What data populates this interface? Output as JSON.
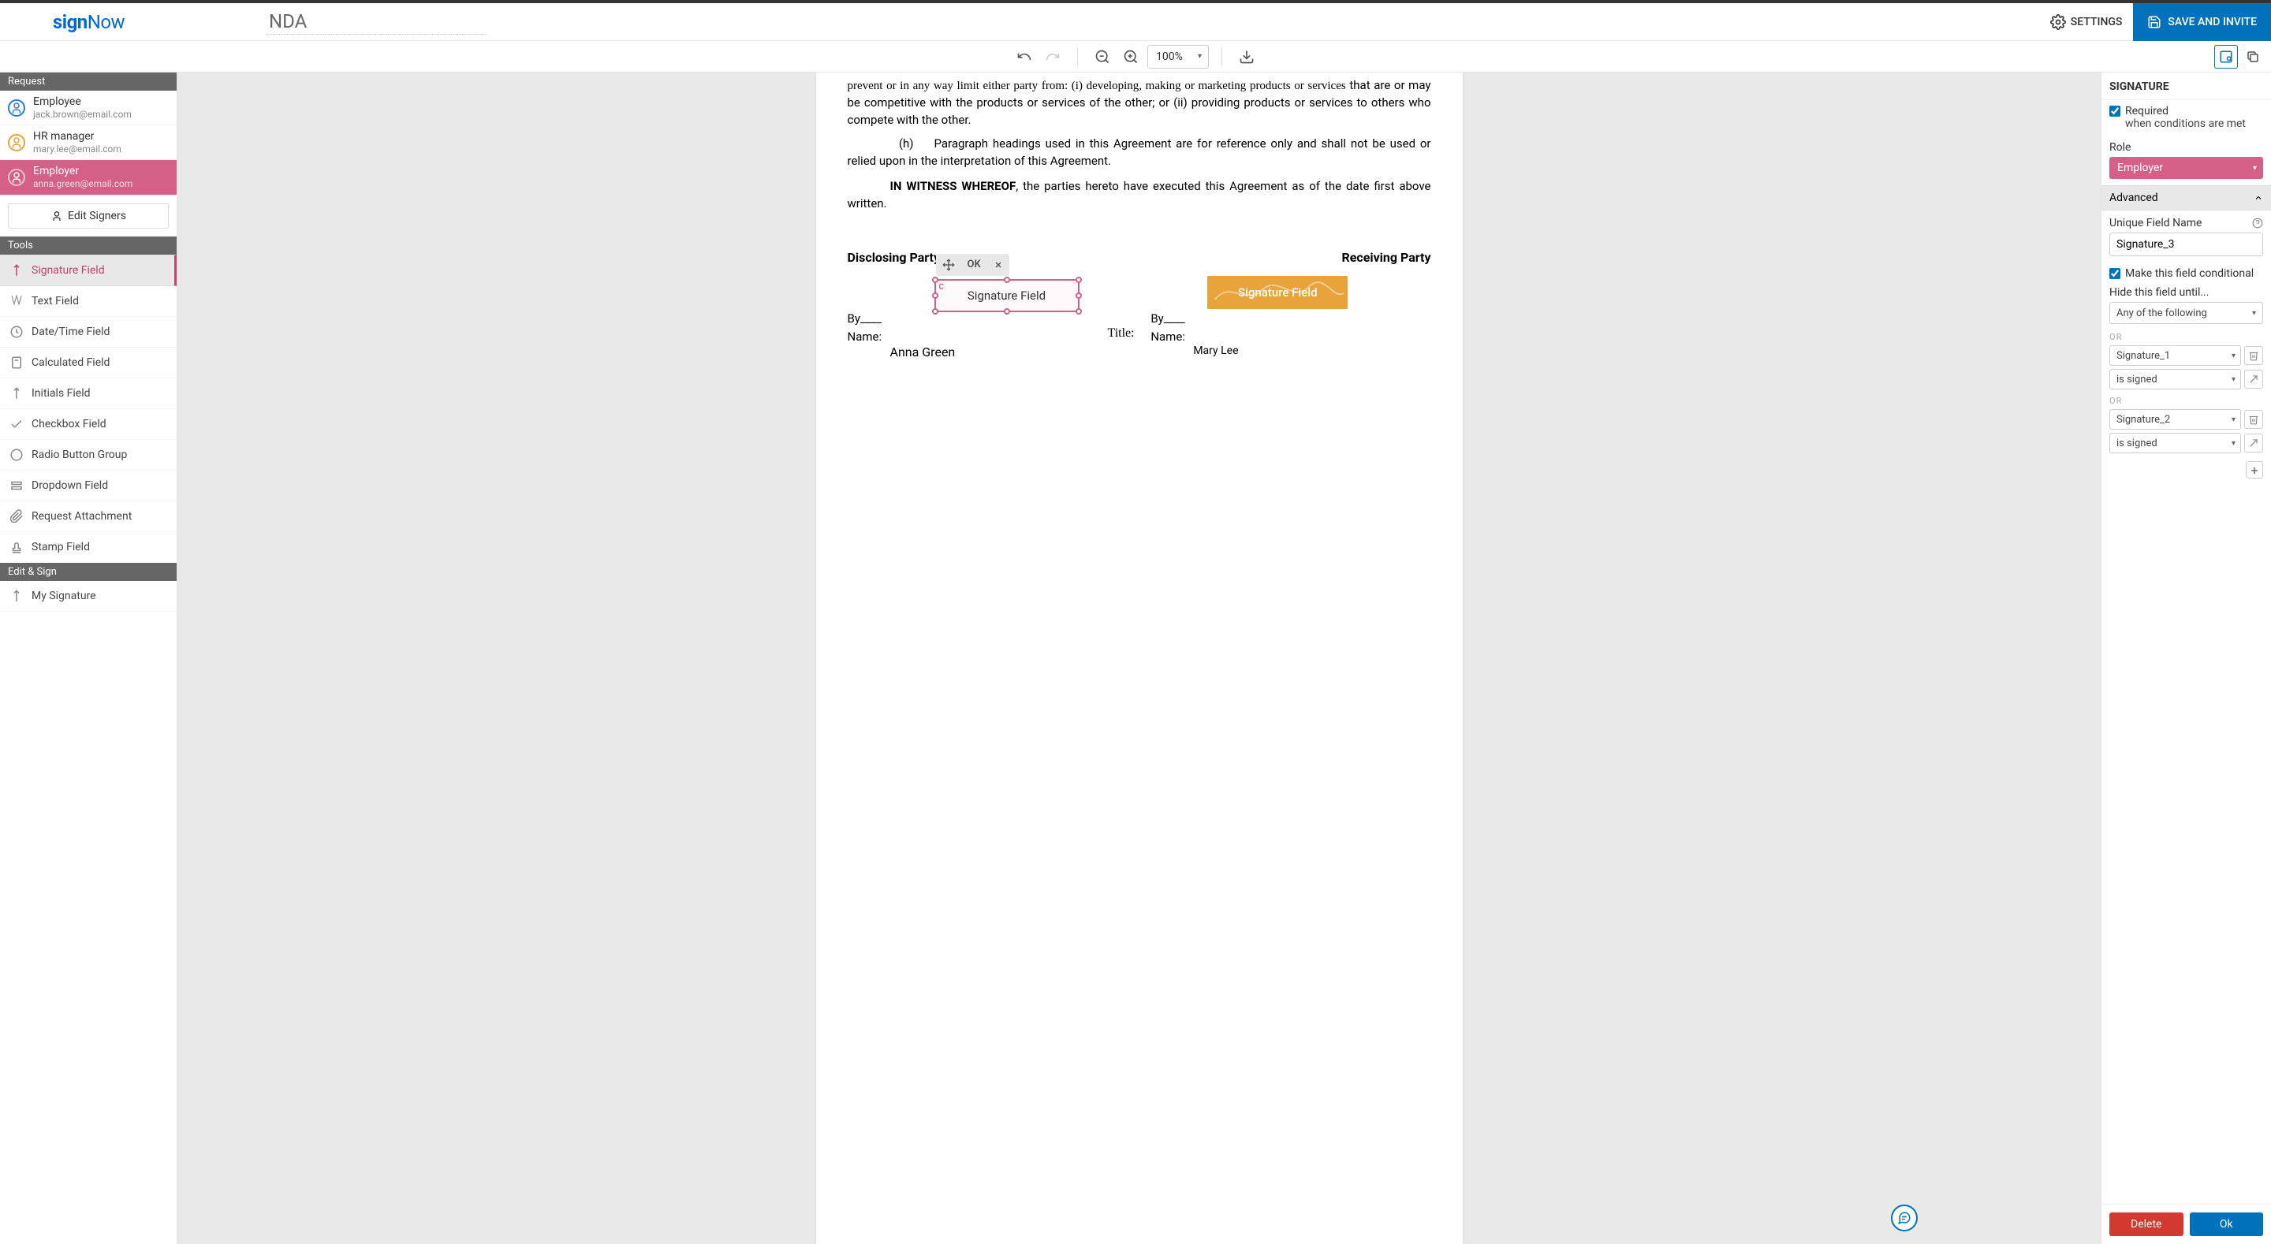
{
  "header": {
    "logo_sign": "sign",
    "logo_now": "Now",
    "doc_title": "NDA",
    "settings": "SETTINGS",
    "save_invite": "SAVE AND INVITE"
  },
  "toolbar": {
    "zoom": "100%"
  },
  "left": {
    "request_head": "Request",
    "signers": [
      {
        "role": "Employee",
        "email": "jack.brown@email.com",
        "color": "#2a7de1",
        "active": false
      },
      {
        "role": "HR manager",
        "email": "mary.lee@email.com",
        "color": "#e8a33a",
        "active": false
      },
      {
        "role": "Employer",
        "email": "anna.green@email.com",
        "color": "#d45f87",
        "active": true
      }
    ],
    "edit_signers": "Edit Signers",
    "tools_head": "Tools",
    "tools": [
      {
        "label": "Signature Field",
        "active": true
      },
      {
        "label": "Text Field",
        "active": false
      },
      {
        "label": "Date/Time Field",
        "active": false
      },
      {
        "label": "Calculated Field",
        "active": false
      },
      {
        "label": "Initials Field",
        "active": false
      },
      {
        "label": "Checkbox Field",
        "active": false
      },
      {
        "label": "Radio Button Group",
        "active": false
      },
      {
        "label": "Dropdown Field",
        "active": false
      },
      {
        "label": "Request Attachment",
        "active": false
      },
      {
        "label": "Stamp Field",
        "active": false
      }
    ],
    "editsign_head": "Edit & Sign",
    "editsign_items": [
      {
        "label": "My Signature"
      }
    ]
  },
  "doc": {
    "line1": "that are or may be competitive with the products or services of the other; or (ii) providing products or services to others who compete with the other.",
    "h_marker": "(h)",
    "h_text": "Paragraph headings used in this Agreement are for reference only and shall not be used or relied upon in the interpretation of this Agreement.",
    "witness_bold": "IN WITNESS WHEREOF",
    "witness_rest": ", the parties hereto have executed this Agreement as of the date first above written.",
    "disclosing": "Disclosing Party",
    "receiving": "Receiving Party",
    "by": "By____",
    "name_label": "Name:",
    "name_left": "Anna Green",
    "name_right": "Mary Lee",
    "title_label": "Title:",
    "field_label_selected": "Signature Field",
    "field_label_orange": "Signature Field",
    "field_ok": "OK",
    "field_c": "C"
  },
  "right": {
    "title": "SIGNATURE",
    "required": "Required",
    "required_sub": "when conditions are met",
    "role_label": "Role",
    "role_value": "Employer",
    "advanced": "Advanced",
    "unique_label": "Unique Field Name",
    "unique_value": "Signature_3",
    "conditional_label": "Make this field conditional",
    "hide_until": "Hide this field until...",
    "any_following": "Any of the following",
    "or": "OR",
    "conditions": [
      {
        "field": "Signature_1",
        "op": "is signed"
      },
      {
        "field": "Signature_2",
        "op": "is signed"
      }
    ],
    "delete": "Delete",
    "ok": "Ok"
  }
}
